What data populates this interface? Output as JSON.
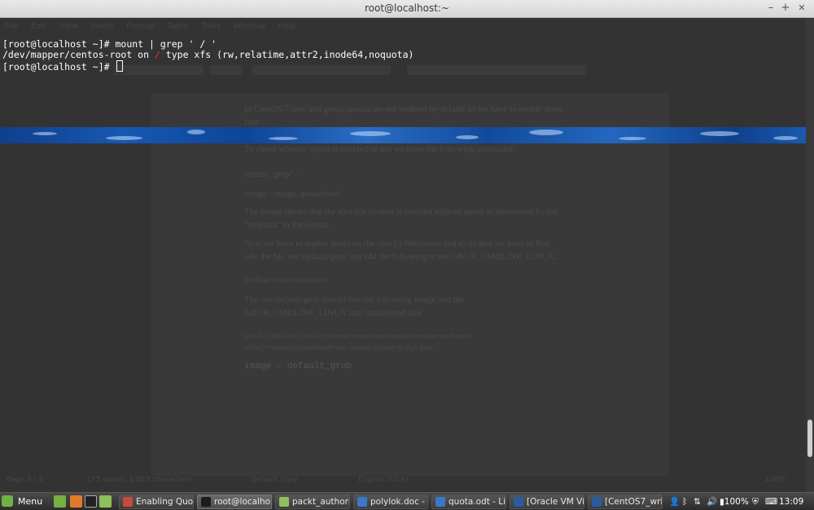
{
  "window": {
    "title": "root@localhost:~",
    "buttons": {
      "minimize": "–",
      "maximize": "+",
      "close": "✕"
    }
  },
  "terminal": {
    "line1": "[root@localhost ~]# mount | grep ' / '",
    "line2_a": "/dev/mapper/centos-root on ",
    "line2_slash": "/",
    "line2_b": " type xfs (rw,relatime,attr2,inode64,noquota)",
    "line3": "[root@localhost ~]# "
  },
  "ghost_document": {
    "menu": [
      "File",
      "Edit",
      "View",
      "Insert",
      "Format",
      "Table",
      "Tools",
      "Window",
      "Help"
    ],
    "style_box": "Preformatted Text",
    "lines": [
      "In CentOS 7 user and group quotas are not enabled by default so we have to enable them",
      "first.",
      "To check whether quota is enabled or not we issue the following command:",
      "mount | grep ' / '",
      "image - image_quotacheck",
      "The image shows that the root file system is enabled without quota as mentioned by the",
      "\"noquota\" in the output.",
      "Now we have to enable quota on the root (/) filesystem and to do that we have to first",
      "edit the file /etc/default/grub and add the following to the GRUB_CMDLINE_LINUX:",
      "rootflags=usrquota,grpquota",
      "The /etc/default/grub should like the following image and the",
      "GRUB_CMDLINE_LINUX line should read like",
      "GRUB_CMDLINE_LINUX=\"rd.lvm.lv=centos/swap vconsole.font=latarcyrheb-sun16",
      "rd.lvm.lv=centos/root crashkernel=auto vconsole.keymap=us rhgb quiet\"",
      "image - default_grub"
    ],
    "status": [
      "Page 3 / 3",
      "175 words, 1,023 characters",
      "Default Style",
      "English (USA)",
      "100%"
    ]
  },
  "scrollbar": {
    "position": 0.92
  },
  "taskbar": {
    "menu_label": "Menu",
    "tasks": [
      {
        "label": "Enabling Quot...",
        "icon": "libreoffice-icon",
        "active": false
      },
      {
        "label": "root@localho...",
        "icon": "terminal-icon",
        "active": true
      },
      {
        "label": "packt_authoring",
        "icon": "folder-icon",
        "active": false
      },
      {
        "label": "polylok.doc - L...",
        "icon": "writer-doc-icon",
        "active": false
      },
      {
        "label": "quota.odt - Lib...",
        "icon": "writer-doc-icon",
        "active": false
      },
      {
        "label": "[Oracle VM Vi...",
        "icon": "virtualbox-icon",
        "active": false
      },
      {
        "label": "[CentOS7_writ...",
        "icon": "virtualbox-icon",
        "active": false
      }
    ],
    "battery": "100%",
    "clock": "13:09"
  },
  "colors": {
    "terminal_bg": "#333333",
    "terminal_text": "#ffffff",
    "highlight_red": "#e03030",
    "wave_blue": "#1758b2",
    "taskbar_bg": "#3a3a3a"
  }
}
